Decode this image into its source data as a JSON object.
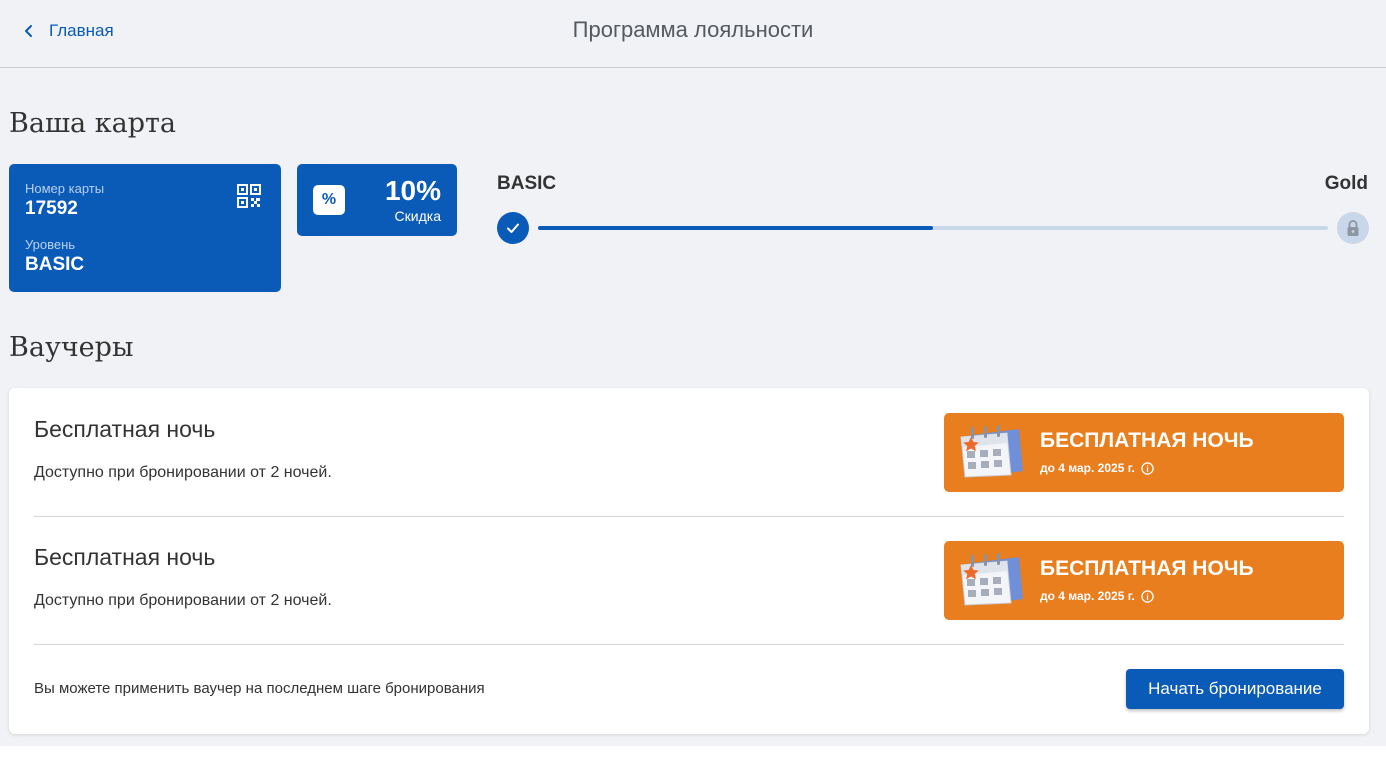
{
  "header": {
    "back_label": "Главная",
    "title": "Программа лояльности"
  },
  "card_section": {
    "title": "Ваша карта",
    "card": {
      "number_label": "Номер карты",
      "number": "17592",
      "level_label": "Уровень",
      "level": "BASIC"
    },
    "discount": {
      "icon_symbol": "%",
      "value": "10%",
      "label": "Скидка"
    },
    "progress": {
      "from_level": "BASIC",
      "to_level": "Gold",
      "fraction": 0.5
    }
  },
  "vouchers_section": {
    "title": "Ваучеры",
    "items": [
      {
        "title": "Бесплатная ночь",
        "description": "Доступно при бронировании от 2 ночей.",
        "badge_title": "БЕСПЛАТНАЯ НОЧЬ",
        "badge_expiry": "до 4 мар. 2025 г."
      },
      {
        "title": "Бесплатная ночь",
        "description": "Доступно при бронировании от 2 ночей.",
        "badge_title": "БЕСПЛАТНАЯ НОЧЬ",
        "badge_expiry": "до 4 мар. 2025 г."
      }
    ],
    "footer_hint": "Вы можете применить ваучер на последнем шаге бронирования",
    "start_button": "Начать бронирование"
  },
  "colors": {
    "primary": "#0a5ab8",
    "voucher_orange": "#e87e1e",
    "background": "#f0f2f5",
    "track": "#c8d8ea"
  },
  "icons": [
    "chevron-left-icon",
    "qr-code-icon",
    "percent-icon",
    "check-icon",
    "lock-icon",
    "calendar-icon",
    "info-icon"
  ]
}
